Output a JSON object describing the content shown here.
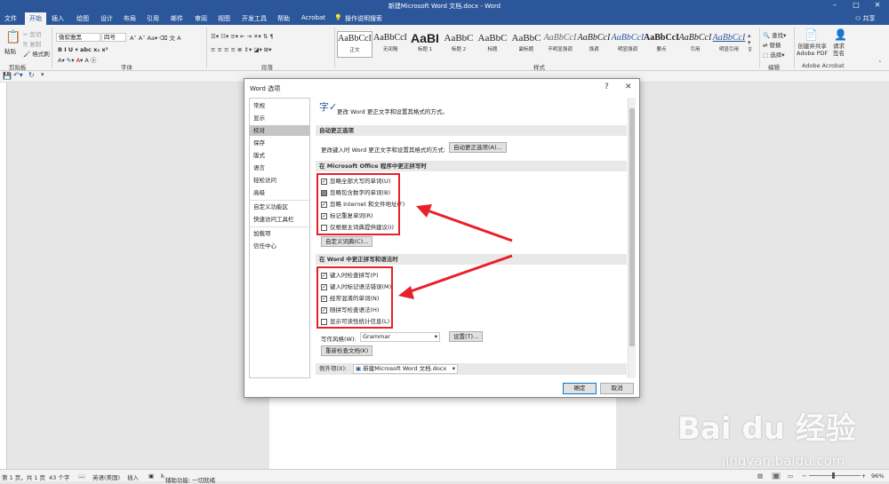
{
  "window": {
    "title": "新建Microsoft Word 文档.docx - Word",
    "controls": [
      "–",
      "□",
      "✕"
    ]
  },
  "tabs": [
    "文件",
    "开始",
    "插入",
    "绘图",
    "设计",
    "布局",
    "引用",
    "邮件",
    "审阅",
    "视图",
    "开发工具",
    "帮助",
    "Acrobat",
    "操作说明搜索"
  ],
  "share_label": "共享",
  "ribbon": {
    "clipboard": {
      "paste": "粘贴",
      "cut": "剪切",
      "copy": "复制",
      "format_painter": "格式刷",
      "label": "剪贴板"
    },
    "font": {
      "name": "微软雅黑",
      "size": "四号",
      "label": "字体"
    },
    "paragraph": {
      "label": "段落"
    },
    "styles": {
      "label": "样式",
      "items": [
        {
          "preview": "AaBbCcI",
          "name": "正文"
        },
        {
          "preview": "AaBbCcI",
          "name": "无间隔"
        },
        {
          "preview": "AaBI",
          "name": "标题 1"
        },
        {
          "preview": "AaBbC",
          "name": "标题 2"
        },
        {
          "preview": "AaBbC",
          "name": "标题"
        },
        {
          "preview": "AaBbC",
          "name": "副标题"
        },
        {
          "preview": "AaBbCcI",
          "name": "不明显强调"
        },
        {
          "preview": "AaBbCcI",
          "name": "强调"
        },
        {
          "preview": "AaBbCcI",
          "name": "明显强调"
        },
        {
          "preview": "AaBbCcI",
          "name": "要点"
        },
        {
          "preview": "AaBbCcI",
          "name": "引用"
        },
        {
          "preview": "AaBbCcI",
          "name": "明显引用"
        }
      ]
    },
    "editing": {
      "find": "查找",
      "replace": "替换",
      "select": "选择",
      "label": "编辑"
    },
    "acrobat": {
      "create_share": "创建并共享\nAdobe PDF",
      "request_sign": "请求\n签名",
      "label": "Adobe Acrobat"
    }
  },
  "dialog": {
    "title": "Word 选项",
    "help": "?",
    "close": "✕",
    "nav": [
      "常规",
      "显示",
      "校对",
      "保存",
      "版式",
      "语言",
      "轻松访问",
      "高级",
      "自定义功能区",
      "快速访问工具栏",
      "加载项",
      "信任中心"
    ],
    "active_nav": "校对",
    "header_text": "更改 Word 更正文字和设置其格式的方式。",
    "autocorrect": {
      "heading": "自动更正选项",
      "desc": "更改键入时 Word 更正文字和设置其格式的方式:",
      "button": "自动更正选项(A)..."
    },
    "office_section": {
      "heading": "在 Microsoft Office 程序中更正拼写时",
      "options": [
        {
          "label": "忽略全部大写的单词(U)",
          "state": "checked"
        },
        {
          "label": "忽略包含数字的单词(B)",
          "state": "partial"
        },
        {
          "label": "忽略 Internet 和文件地址(F)",
          "state": "checked"
        },
        {
          "label": "标记重复单词(R)",
          "state": "checked"
        },
        {
          "label": "仅根据主词典提供建议(I)",
          "state": "unchecked"
        }
      ],
      "custom_dict_button": "自定义词典(C)..."
    },
    "word_section": {
      "heading": "在 Word 中更正拼写和语法时",
      "options": [
        {
          "label": "键入时检查拼写(P)",
          "state": "checked"
        },
        {
          "label": "键入时标记语法错误(M)",
          "state": "checked"
        },
        {
          "label": "经常混淆的单词(N)",
          "state": "checked"
        },
        {
          "label": "随拼写检查语法(H)",
          "state": "checked"
        },
        {
          "label": "显示可读性统计信息(L)",
          "state": "unchecked"
        }
      ],
      "writing_style_label": "写作风格(W):",
      "writing_style_value": "Grammar",
      "settings_button": "设置(T)...",
      "recheck_button": "重新检查文档(K)"
    },
    "exceptions": {
      "label": "例外项(X):",
      "value": "新建Microsoft Word 文档.docx"
    },
    "ok": "确定",
    "cancel": "取消"
  },
  "statusbar": {
    "page": "第 1 页，共 1 页",
    "words": "43 个字",
    "lang": "英语(美国)",
    "mode": "插入",
    "accessibility": "辅助功能: 一切就绪",
    "zoom": "96%"
  },
  "watermark": {
    "brand": "Bai du 经验",
    "url": "jingyan.baidu.com"
  },
  "colors": {
    "accent": "#2b579a",
    "annotation": "#e8202a"
  }
}
